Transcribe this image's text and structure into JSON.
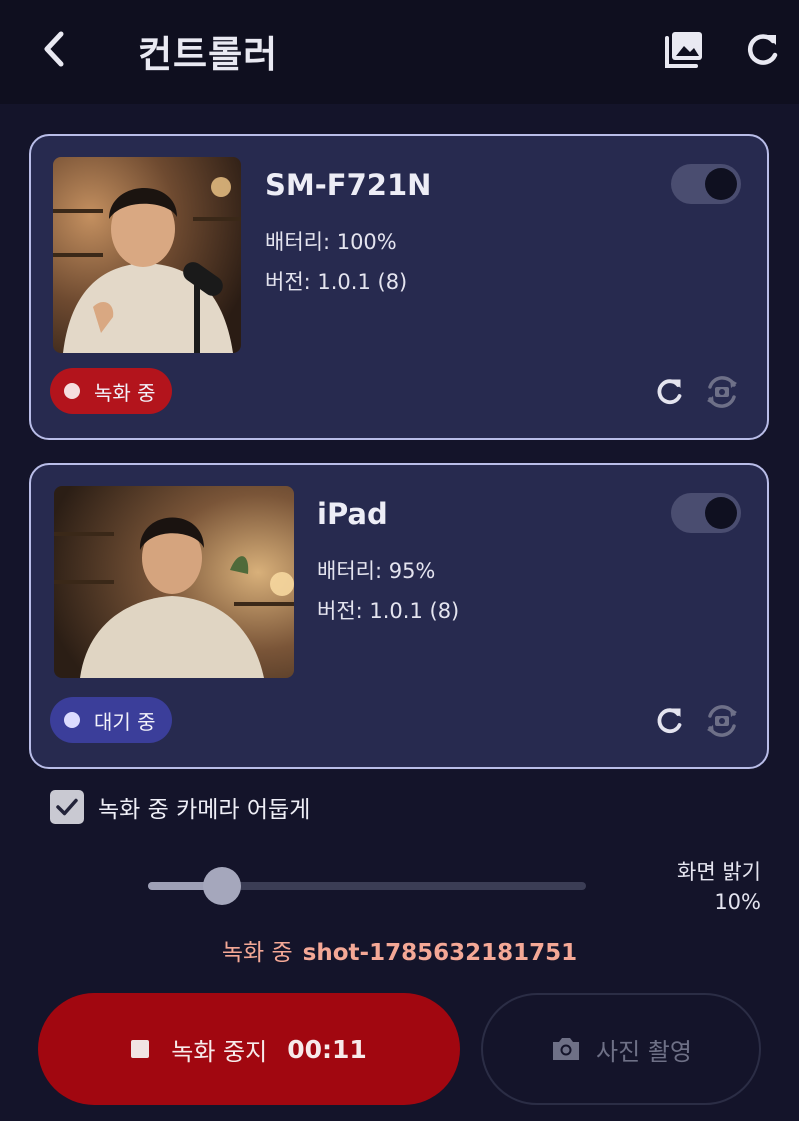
{
  "header": {
    "title": "컨트롤러",
    "back_icon": "chevron-left-icon",
    "gallery_icon": "photo-library-icon",
    "refresh_icon": "refresh-icon"
  },
  "devices": [
    {
      "name": "SM-F721N",
      "battery": "배터리: 100%",
      "version": "버전: 1.0.1 (8)",
      "status": "녹화 중",
      "status_color": "#b3141c",
      "toggle_on": true
    },
    {
      "name": "iPad",
      "battery": "배터리: 95%",
      "version": "버전: 1.0.1 (8)",
      "status": "대기 중",
      "status_color": "#3b3e9a",
      "toggle_on": true
    }
  ],
  "options": {
    "dim_camera_label": "녹화 중 카메라 어둡게",
    "dim_camera_checked": true
  },
  "brightness": {
    "label": "화면 밝기",
    "value_text": "10%",
    "value": 0.1
  },
  "recording": {
    "prefix": "녹화 중",
    "shot_name": "shot-1785632181751"
  },
  "buttons": {
    "stop_label": "녹화 중지",
    "timer": "00:11",
    "photo_label": "사진 촬영"
  },
  "colors": {
    "background": "#14142a",
    "card": "#272a4f",
    "card_border": "#b9bde8",
    "record_red": "#a10710",
    "accent_text": "#f4a896"
  }
}
